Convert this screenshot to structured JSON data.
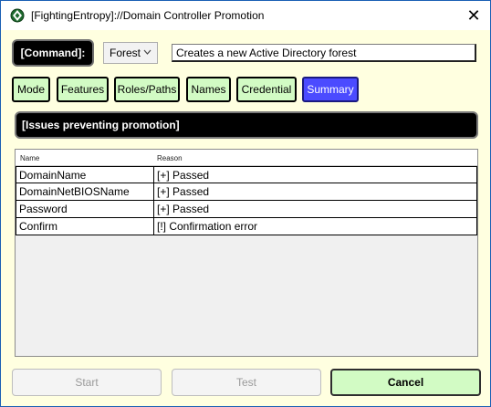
{
  "window": {
    "title": "[FightingEntropy]://Domain Controller Promotion",
    "close_glyph": "✕"
  },
  "command": {
    "label": "[Command]:",
    "mode_value": "Forest",
    "description": "Creates a new Active Directory forest"
  },
  "tabs": [
    {
      "label": "Mode",
      "active": false
    },
    {
      "label": "Features",
      "active": false
    },
    {
      "label": "Roles/Paths",
      "active": false
    },
    {
      "label": "Names",
      "active": false
    },
    {
      "label": "Credential",
      "active": false
    },
    {
      "label": "Summary",
      "active": true
    }
  ],
  "summary": {
    "header": "[Issues preventing promotion]",
    "columns": [
      "Name",
      "Reason"
    ],
    "rows": [
      {
        "name": "DomainName",
        "reason": "[+] Passed"
      },
      {
        "name": "DomainNetBIOSName",
        "reason": "[+] Passed"
      },
      {
        "name": "Password",
        "reason": "[+] Passed"
      },
      {
        "name": "Confirm",
        "reason": "[!] Confirmation error"
      }
    ]
  },
  "buttons": {
    "start": "Start",
    "test": "Test",
    "cancel": "Cancel"
  },
  "colors": {
    "window_bg": "#ffffe0",
    "tab_bg": "#d2fbc4",
    "tab_active_bg": "#4b4bff",
    "header_bg": "#000000",
    "accent_border": "#1a5fb4"
  },
  "icons": {
    "app": "fighting-entropy-logo-icon",
    "close": "close-icon",
    "dropdown": "chevron-down-icon"
  }
}
